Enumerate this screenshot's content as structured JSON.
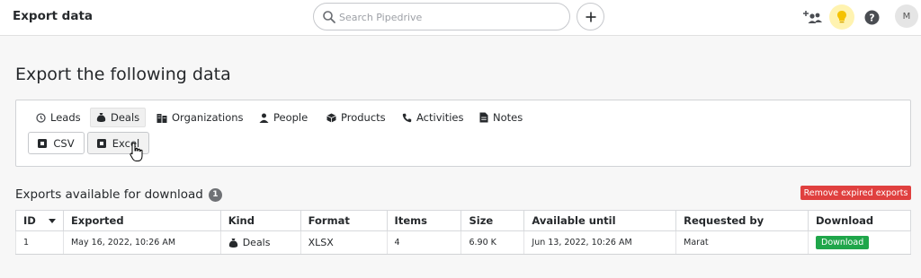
{
  "header": {
    "title": "Export data",
    "search_placeholder": "Search Pipedrive",
    "avatar_initial": "M"
  },
  "page": {
    "title": "Export the following data"
  },
  "tabs": [
    {
      "label": "Leads",
      "icon": "clock-icon",
      "active": false
    },
    {
      "label": "Deals",
      "icon": "money-bag-icon",
      "active": true
    },
    {
      "label": "Organizations",
      "icon": "building-icon",
      "active": false
    },
    {
      "label": "People",
      "icon": "person-icon",
      "active": false
    },
    {
      "label": "Products",
      "icon": "box-icon",
      "active": false
    },
    {
      "label": "Activities",
      "icon": "phone-icon",
      "active": false
    },
    {
      "label": "Notes",
      "icon": "note-icon",
      "active": false
    }
  ],
  "formats": {
    "csv_label": "CSV",
    "excel_label": "Excel"
  },
  "exports": {
    "title": "Exports available for download",
    "count": "1",
    "remove_label": "Remove expired exports",
    "columns": [
      "ID",
      "Exported",
      "Kind",
      "Format",
      "Items",
      "Size",
      "Available until",
      "Requested by",
      "Download"
    ],
    "rows": [
      {
        "id": "1",
        "exported": "May 16, 2022, 10:26 AM",
        "kind": "Deals",
        "format": "XLSX",
        "items": "4",
        "size": "6.90 K",
        "available_until": "Jun 13, 2022, 10:26 AM",
        "requested_by": "Marat",
        "download_label": "Download"
      }
    ]
  },
  "colors": {
    "remove_red": "#e0403f",
    "download_green": "#1fa64a",
    "bulb_yellow": "#f5c200"
  }
}
